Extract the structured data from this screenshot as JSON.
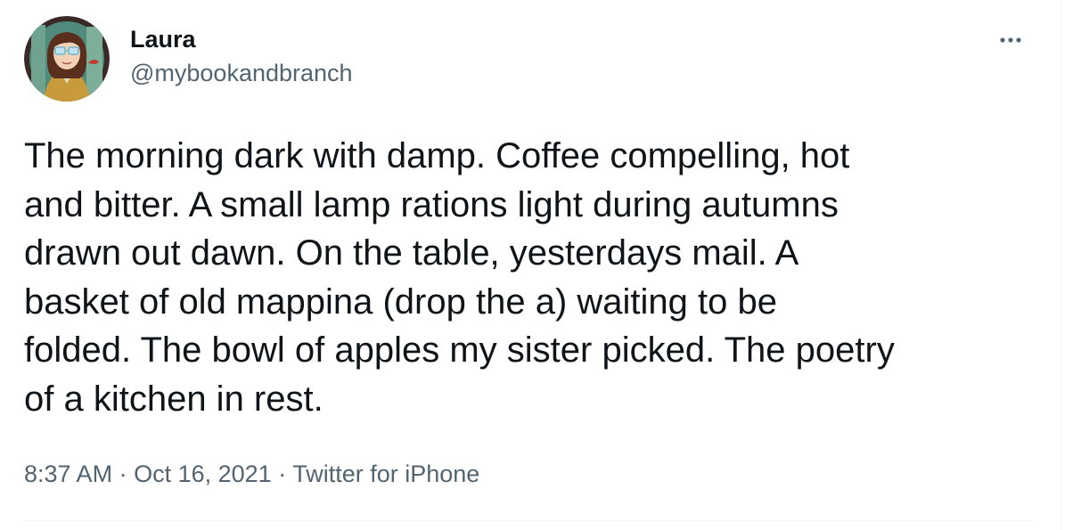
{
  "author": {
    "display_name": "Laura",
    "handle": "@mybookandbranch"
  },
  "tweet": {
    "text": "The morning dark with damp. Coffee compelling, hot\nand bitter. A small lamp rations light during autumns\ndrawn out dawn. On the table, yesterdays mail. A\nbasket of old mappina (drop the a) waiting to be\nfolded. The bowl of apples my sister picked. The poetry\nof a kitchen in rest."
  },
  "meta": {
    "time": "8:37 AM",
    "separator": "·",
    "date": "Oct 16, 2021",
    "source": "Twitter for iPhone"
  },
  "icons": {
    "more": "more-horizontal-icon",
    "avatar": "avatar-illustration"
  },
  "colors": {
    "text_primary": "#0f1419",
    "text_secondary": "#536471",
    "divider": "#eff3f4"
  }
}
